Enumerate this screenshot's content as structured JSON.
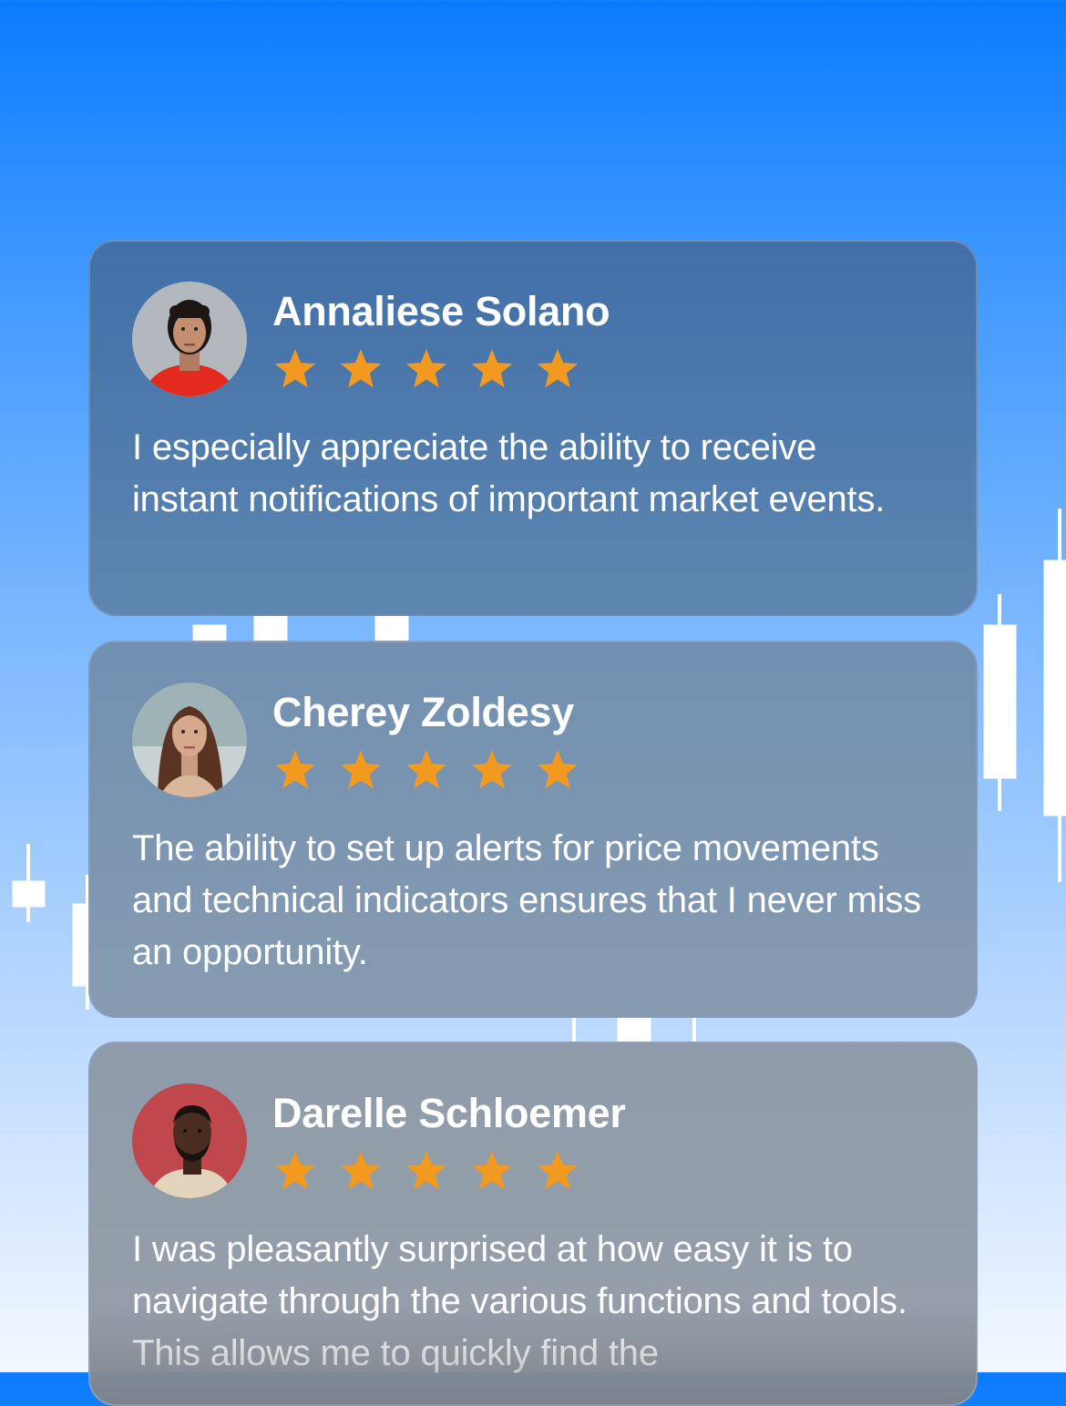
{
  "colors": {
    "background_top": "#0a7cff",
    "background_bottom": "#f3f8ff",
    "star": "#f29a20",
    "text": "#ffffff"
  },
  "reviews": [
    {
      "name": "Annaliese Solano",
      "rating": 5,
      "avatar": "woman-portrait-avatar",
      "text": "I especially appreciate the ability to receive instant notifications of important market events."
    },
    {
      "name": "Cherey Zoldesy",
      "rating": 5,
      "avatar": "woman-portrait-avatar",
      "text": "The ability to set up alerts for price movements and technical indicators ensures that I never miss an opportunity."
    },
    {
      "name": "Darelle Schloemer",
      "rating": 5,
      "avatar": "man-portrait-avatar",
      "text": "I was pleasantly surprised at how easy it is to navigate through the various functions and tools. This allows me to quickly find the"
    }
  ]
}
